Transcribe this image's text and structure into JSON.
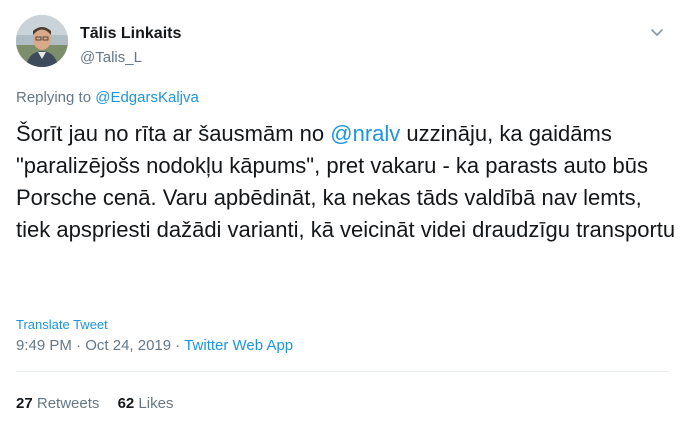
{
  "author": {
    "name": "Tālis Linkaits",
    "handle": "@Talis_L",
    "avatar_icon": "profile-photo"
  },
  "reply": {
    "prefix": "Replying to ",
    "target": "@EdgarsKaljva"
  },
  "tweet": {
    "part1": "Šorīt jau no rīta ar šausmām no ",
    "mention": "@nralv",
    "part2": " uzzināju, ka gaidāms \"paralizējošs nodokļu kāpums\", pret vakaru - ka parasts auto būs Porsche cenā. Varu apbēdināt, ka nekas tāds valdībā nav lemts, tiek apspriesti dažādi varianti, kā veicināt videi draudzīgu transportu"
  },
  "translate_label": "Translate Tweet",
  "meta": {
    "time": "9:49 PM",
    "sep1": " · ",
    "date": "Oct 24, 2019",
    "sep2": " · ",
    "source": "Twitter Web App"
  },
  "stats": {
    "retweets_count": "27",
    "retweets_label": "Retweets",
    "likes_count": "62",
    "likes_label": "Likes"
  },
  "colors": {
    "link": "#1b95e0",
    "secondary": "#657786",
    "text": "#14171a"
  }
}
